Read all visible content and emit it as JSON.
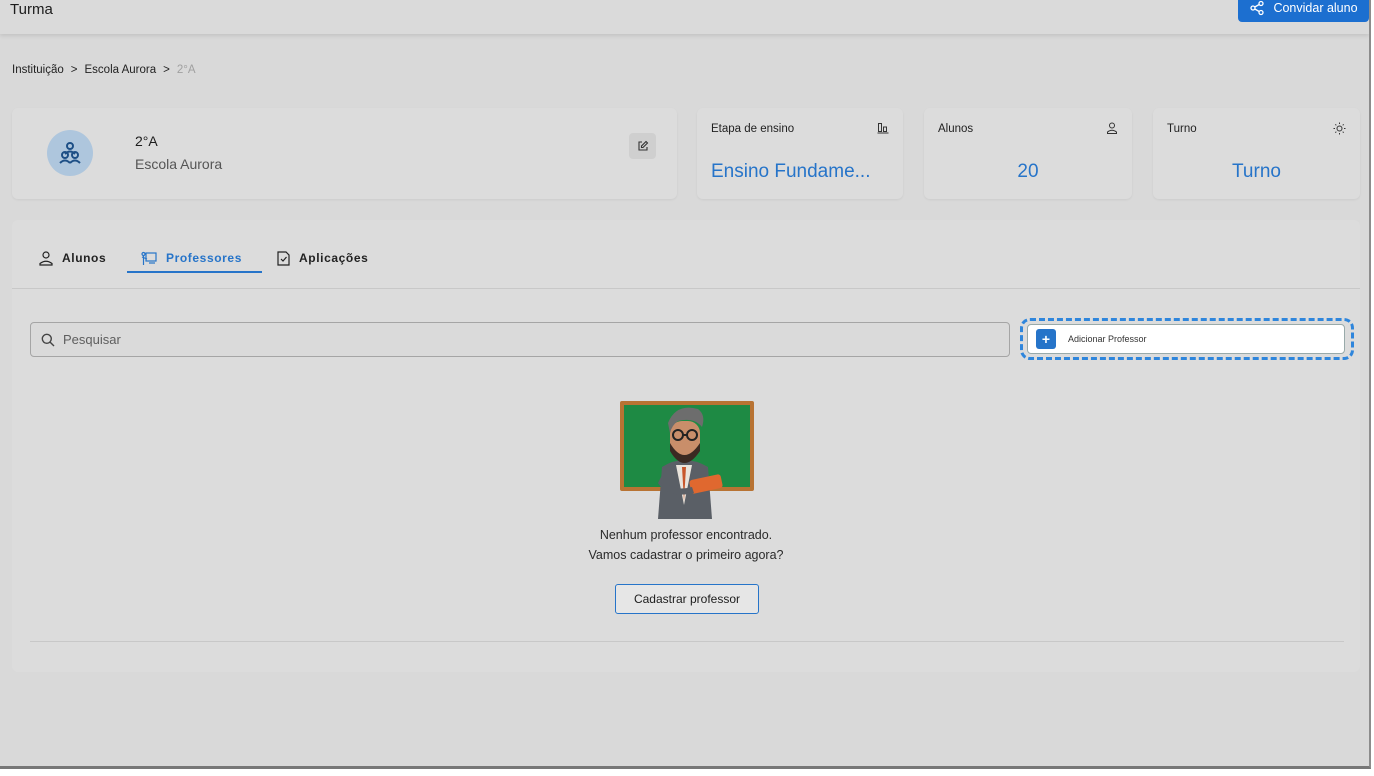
{
  "header": {
    "title": "Turma",
    "invite_label": "Convidar aluno"
  },
  "breadcrumb": {
    "items": [
      "Instituição",
      "Escola Aurora"
    ],
    "current": "2°A",
    "separator": ">"
  },
  "profile": {
    "class_name": "2°A",
    "school_name": "Escola Aurora"
  },
  "stats": [
    {
      "label": "Etapa de ensino",
      "value": "Ensino Fundame...",
      "icon": "bar-chart-icon"
    },
    {
      "label": "Alunos",
      "value": "20",
      "icon": "person-icon"
    },
    {
      "label": "Turno",
      "value": "Turno",
      "icon": "sun-icon"
    }
  ],
  "tabs": [
    {
      "label": "Alunos",
      "icon": "person-icon"
    },
    {
      "label": "Professores",
      "icon": "teacher-board-icon",
      "active": true
    },
    {
      "label": "Aplicações",
      "icon": "checked-document-icon"
    }
  ],
  "search": {
    "placeholder": "Pesquisar",
    "value": ""
  },
  "add_professor": {
    "label": "Adicionar Professor"
  },
  "empty_state": {
    "line1": "Nenhum professor encontrado.",
    "line2": "Vamos cadastrar o primeiro agora?",
    "button_label": "Cadastrar professor"
  },
  "colors": {
    "accent": "#2674c9",
    "primary_button": "#1c6fd0",
    "background": "#d9d9d9",
    "chalkboard": "#1e8a44"
  }
}
